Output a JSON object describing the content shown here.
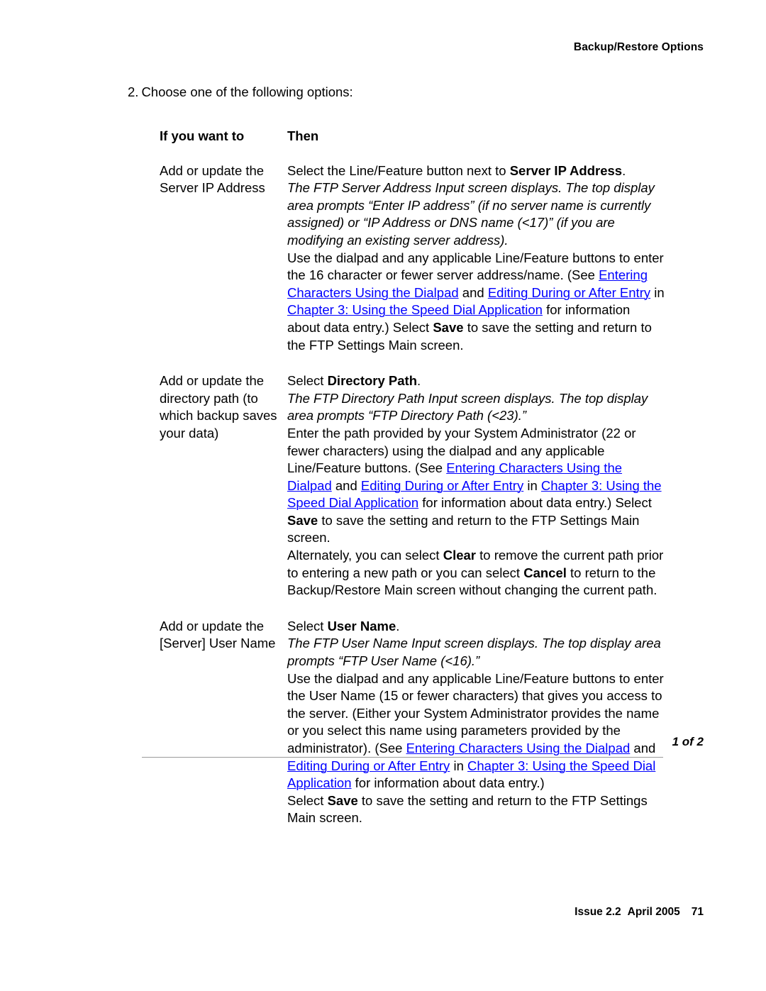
{
  "header": {
    "running_head": "Backup/Restore Options"
  },
  "step": {
    "number": "2.",
    "text": "Choose one of the following options:"
  },
  "table": {
    "headers": {
      "col_a": "If you want to",
      "col_b": "Then"
    },
    "rows": [
      {
        "condition": "Add or update the Server IP Address",
        "action_lead_1": "Select the Line/Feature button next to ",
        "action_lead_1_bold": "Server IP Address",
        "action_lead_1_tail": ".",
        "italic_note": "The FTP Server Address Input screen displays. The top display area prompts “Enter IP address” (if no server name is currently assigned) or “IP Address or DNS name (<17)” (if you are modifying an existing server address).",
        "body_1": "Use the dialpad and any applicable Line/Feature buttons to enter the 16 character or fewer server address/name. (See ",
        "link_1": "Entering Characters Using the Dialpad",
        "conj_1": " and ",
        "link_2": "Editing During or After Entry",
        "conj_2": " in ",
        "link_3": "Chapter 3: Using the Speed Dial Application",
        "body_2": " for information about data entry.) Select ",
        "bold_save": "Save",
        "body_3": " to save the setting and return to the FTP Settings Main screen."
      },
      {
        "condition": "Add or update the directory path (to which backup saves your data)",
        "action_lead_1": "Select ",
        "action_lead_1_bold": "Directory Path",
        "action_lead_1_tail": ".",
        "italic_note": "The FTP Directory Path Input screen displays. The top display area prompts “FTP Directory Path (<23).”",
        "body_1": "Enter the path provided by your System Administrator (22 or fewer characters) using the dialpad and any applicable Line/Feature buttons. (See ",
        "link_1": "Entering Characters Using the Dialpad",
        "conj_1": " and ",
        "link_2": "Editing During or After Entry",
        "conj_2": " in ",
        "link_3": "Chapter 3: Using the Speed Dial Application",
        "body_2": " for information about data entry.) Select ",
        "bold_save": "Save",
        "body_3": " to save the setting and return to the FTP Settings Main screen.",
        "alt_1": "Alternately, you can select ",
        "alt_bold_1": "Clear",
        "alt_2": " to remove the current path prior to entering a new path or you can select ",
        "alt_bold_2": "Cancel",
        "alt_3": " to return to the Backup/Restore Main screen without changing the current path."
      },
      {
        "condition": "Add or update the [Server] User Name",
        "action_lead_1": "Select ",
        "action_lead_1_bold": "User Name",
        "action_lead_1_tail": ".",
        "italic_note": "The FTP User Name Input screen displays. The top display area prompts “FTP User Name (<16).”",
        "body_1": "Use the dialpad and any applicable Line/Feature buttons to enter the User Name (15 or fewer characters) that gives you access to the server. (Either your System Administrator provides the name or you select this name using parameters provided by the administrator). (See ",
        "link_1": "Entering Characters Using the Dialpad",
        "conj_1": " and ",
        "link_2": "Editing During or After Entry",
        "conj_2": " in ",
        "link_3": "Chapter 3: Using the Speed Dial Application",
        "body_2": " for information about data entry.)",
        "final_1": "Select ",
        "bold_save": "Save",
        "final_2": " to save the setting and return to the FTP Settings Main screen."
      }
    ],
    "continuation": "1 of 2"
  },
  "footer": {
    "issue": "Issue 2.2",
    "date": "April 2005",
    "page_number": "71"
  },
  "colors": {
    "link": "#0000ff",
    "text": "#000000",
    "rule": "#9a9a9a"
  }
}
